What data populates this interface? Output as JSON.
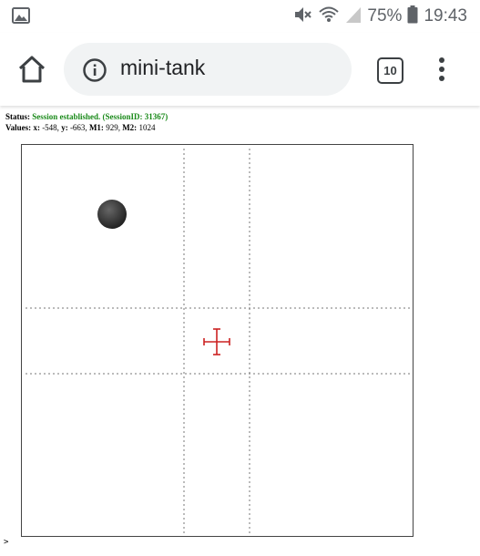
{
  "status_bar": {
    "battery_percent": "75%",
    "time": "19:43",
    "icons": [
      "image-notification-icon",
      "mute-icon",
      "wifi-icon",
      "signal-icon",
      "battery-icon"
    ]
  },
  "browser": {
    "url": "mini-tank",
    "tab_count": "10",
    "icons": [
      "home-icon",
      "info-icon",
      "menu-icon"
    ]
  },
  "page": {
    "status_label": "Status:",
    "status_text": "Session established. (SessionID: 31367)",
    "values_label": "Values:",
    "x_label": "x:",
    "x_value": "-548,",
    "y_label": "y:",
    "y_value": "-663,",
    "m1_label": "M1:",
    "m1_value": "929,",
    "m2_label": "M2:",
    "m2_value": "1024",
    "prompt": ">"
  },
  "colors": {
    "status_ok": "#1a8a1a",
    "crosshair": "#cc2222",
    "joystick": "#333333"
  }
}
